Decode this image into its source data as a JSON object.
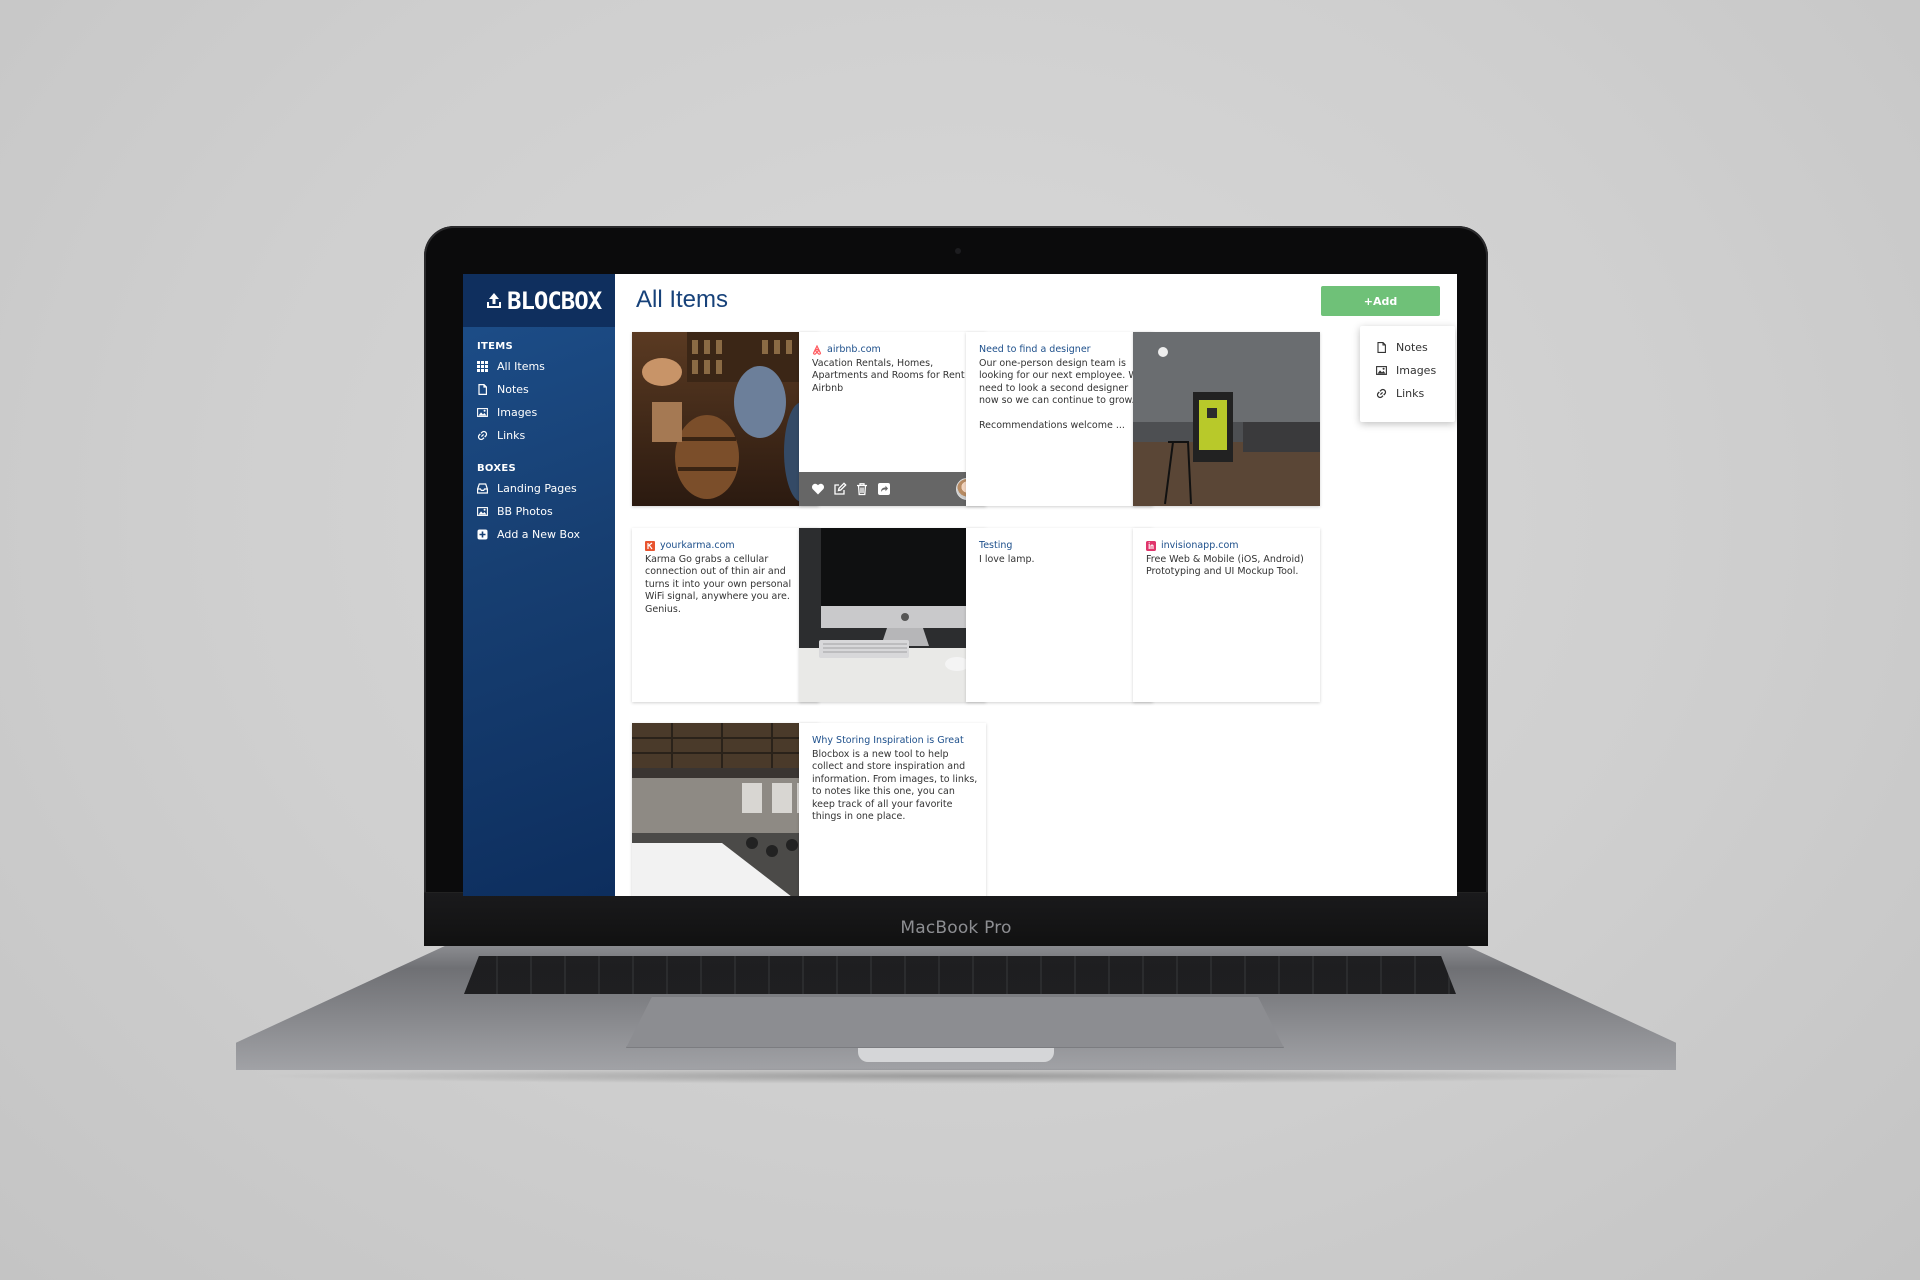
{
  "device": {
    "brand": "MacBook Pro"
  },
  "app": {
    "logo": "BLOCBOX",
    "sidebar": {
      "items_title": "ITEMS",
      "items": [
        {
          "label": "All Items",
          "icon": "grid-icon"
        },
        {
          "label": "Notes",
          "icon": "note-icon"
        },
        {
          "label": "Images",
          "icon": "image-icon"
        },
        {
          "label": "Links",
          "icon": "link-icon"
        }
      ],
      "boxes_title": "BOXES",
      "boxes": [
        {
          "label": "Landing Pages",
          "icon": "inbox-icon"
        },
        {
          "label": "BB Photos",
          "icon": "image-icon"
        },
        {
          "label": "Add a New Box",
          "icon": "plus-box-icon"
        }
      ]
    },
    "main": {
      "title": "All Items",
      "add_label": "+Add",
      "add_menu": [
        "Notes",
        "Images",
        "Links"
      ],
      "cards": [
        {
          "type": "image",
          "alt": "bar-photo"
        },
        {
          "type": "link",
          "source": "airbnb.com",
          "text": "Vacation Rentals, Homes, Apartments and Rooms for Rent - Airbnb"
        },
        {
          "type": "note",
          "title": "Need to find a designer",
          "text": "Our one-person design team is looking for our next employee. We need to look a second designer now so we can continue to grow.\n\nRecommendations welcome ..."
        },
        {
          "type": "image",
          "alt": "office-stand-photo"
        },
        {
          "type": "link",
          "source": "yourkarma.com",
          "text": "Karma Go grabs a cellular connection out of thin air and turns it into your own personal WiFi signal, anywhere you are. Genius."
        },
        {
          "type": "image",
          "alt": "imac-desk-photo"
        },
        {
          "type": "note",
          "title": "Testing",
          "text": "I love lamp."
        },
        {
          "type": "link",
          "source": "invisionapp.com",
          "text": "Free Web & Mobile (iOS, Android) Prototyping and UI Mockup Tool."
        },
        {
          "type": "image",
          "alt": "open-office-photo"
        },
        {
          "type": "note",
          "title": "Why Storing Inspiration is Great",
          "text": "Blocbox is a new tool to help collect and store inspiration and information. From images, to links, to notes like this one, you can keep track of all your favorite things in one place."
        }
      ]
    },
    "colors": {
      "sidebar": "#173f72",
      "title": "#17427a",
      "add_button": "#6fc178",
      "airbnb": "#ff5a5f",
      "karma": "#e8542f",
      "invision": "#e0356c"
    }
  }
}
